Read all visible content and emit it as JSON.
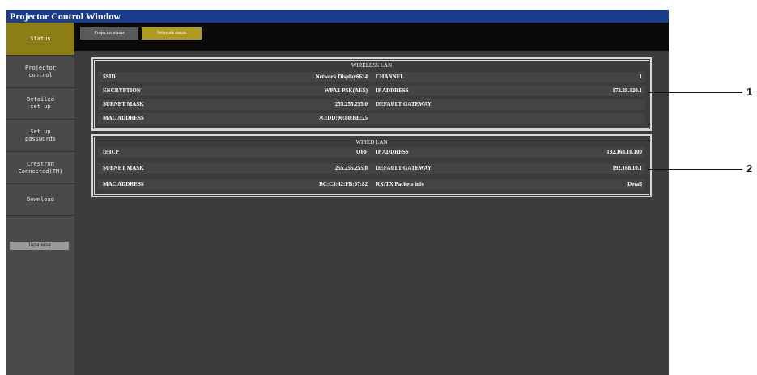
{
  "window": {
    "title": "Projector Control Window"
  },
  "sidebar": {
    "items": [
      {
        "label": "Status"
      },
      {
        "label": "Projector\ncontrol"
      },
      {
        "label": "Detailed\nset up"
      },
      {
        "label": "Set up\npasswords"
      },
      {
        "label": "Crestron\nConnected(TM)"
      },
      {
        "label": "Download"
      }
    ],
    "language_button": "Japanese"
  },
  "tabs": [
    {
      "label": "Projector status"
    },
    {
      "label": "Network status"
    }
  ],
  "wireless_lan": {
    "title": "WIRELESS LAN",
    "rows": [
      {
        "label1": "SSID",
        "value1": "Network Display6634",
        "label2": "CHANNEL",
        "value2": "1"
      },
      {
        "label1": "ENCRYPTION",
        "value1": "WPA2-PSK(AES)",
        "label2": "IP ADDRESS",
        "value2": "172.28.120.1"
      },
      {
        "label1": "SUBNET MASK",
        "value1": "255.255.255.0",
        "label2": "DEFAULT GATEWAY",
        "value2": ""
      },
      {
        "label1": "MAC ADDRESS",
        "value1": "7C:DD:90:80:BE:25",
        "label2": "",
        "value2": ""
      }
    ]
  },
  "wired_lan": {
    "title": "WIRED LAN",
    "rows": [
      {
        "label1": "DHCP",
        "value1": "OFF",
        "label2": "IP ADDRESS",
        "value2": "192.168.10.100"
      },
      {
        "label1": "SUBNET MASK",
        "value1": "255.255.255.0",
        "label2": "DEFAULT GATEWAY",
        "value2": "192.168.10.1"
      },
      {
        "label1": "MAC ADDRESS",
        "value1": "BC:C3:42:FB:97:82",
        "label2": "RX/TX Packets info",
        "value2": "Detail"
      }
    ]
  },
  "callouts": [
    {
      "number": "1"
    },
    {
      "number": "2"
    }
  ],
  "colors": {
    "title_bar": "#1a3e8c",
    "active_nav": "#8c7d14",
    "active_tab": "#b09a20",
    "background": "#3c3c3c"
  }
}
